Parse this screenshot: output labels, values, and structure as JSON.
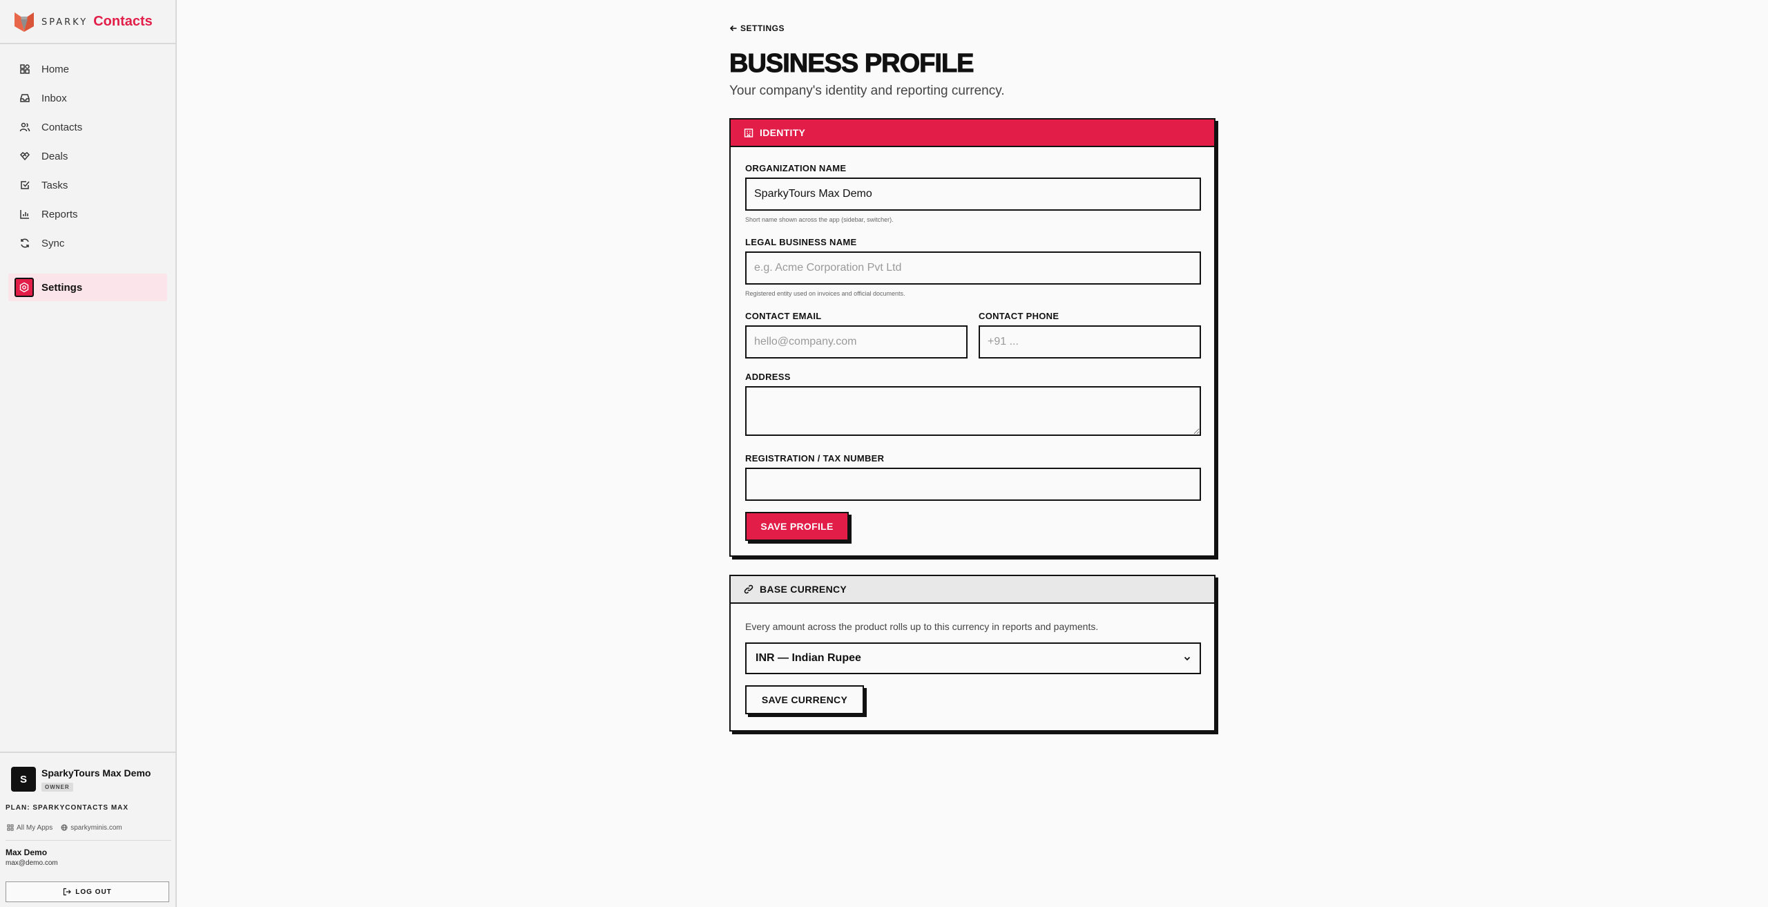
{
  "brand": {
    "sparky": "SPARKY",
    "product": "Contacts",
    "accent": "#e11d48"
  },
  "nav": {
    "items": [
      {
        "label": "Home",
        "icon": "home-icon"
      },
      {
        "label": "Inbox",
        "icon": "inbox-icon"
      },
      {
        "label": "Contacts",
        "icon": "users-icon"
      },
      {
        "label": "Deals",
        "icon": "handshake-icon"
      },
      {
        "label": "Tasks",
        "icon": "checkbox-icon"
      },
      {
        "label": "Reports",
        "icon": "bar-chart-icon"
      },
      {
        "label": "Sync",
        "icon": "refresh-icon"
      }
    ],
    "active": {
      "label": "Settings",
      "icon": "settings-icon"
    }
  },
  "org": {
    "avatar_letter": "S",
    "name": "SparkyTours Max Demo",
    "role": "OWNER",
    "plan": "PLAN: SPARKYCONTACTS MAX"
  },
  "links": {
    "apps": "All My Apps",
    "site": "sparkyminis.com"
  },
  "user": {
    "name": "Max Demo",
    "email": "max@demo.com",
    "logout": "LOG OUT"
  },
  "page": {
    "back": "SETTINGS",
    "title": "BUSINESS PROFILE",
    "subtitle": "Your company's identity and reporting currency."
  },
  "identity": {
    "header": "IDENTITY",
    "org_name": {
      "label": "ORGANIZATION NAME",
      "value": "SparkyTours Max Demo",
      "hint": "Short name shown across the app (sidebar, switcher)."
    },
    "legal_name": {
      "label": "LEGAL BUSINESS NAME",
      "placeholder": "e.g. Acme Corporation Pvt Ltd",
      "hint": "Registered entity used on invoices and official documents."
    },
    "email": {
      "label": "CONTACT EMAIL",
      "placeholder": "hello@company.com"
    },
    "phone": {
      "label": "CONTACT PHONE",
      "placeholder": "+91 ..."
    },
    "address": {
      "label": "ADDRESS",
      "placeholder": ""
    },
    "tax": {
      "label": "REGISTRATION / TAX NUMBER",
      "placeholder": ""
    },
    "save": "SAVE PROFILE"
  },
  "currency": {
    "header": "BASE CURRENCY",
    "description": "Every amount across the product rolls up to this currency in reports and payments.",
    "selected": "INR — Indian Rupee",
    "save": "SAVE CURRENCY"
  }
}
